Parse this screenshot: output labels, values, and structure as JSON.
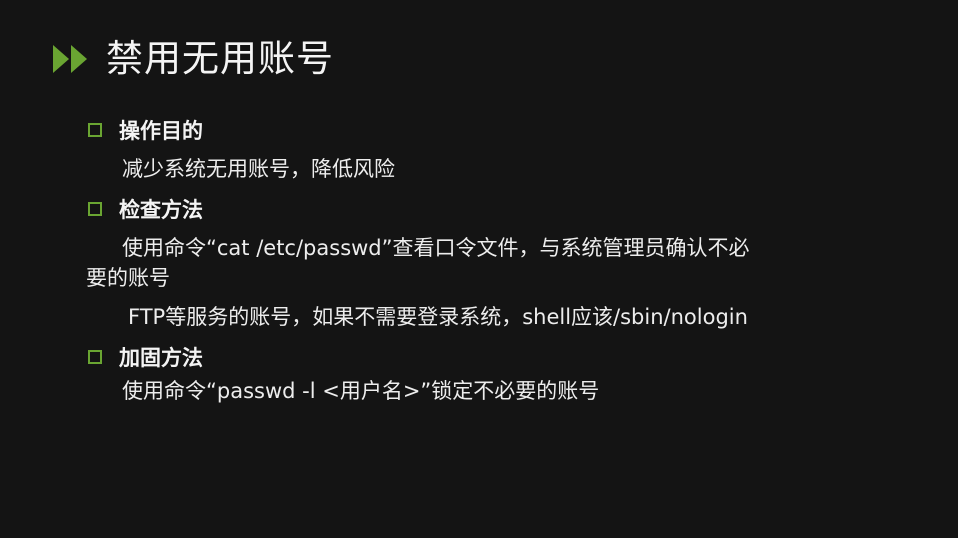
{
  "slide": {
    "title": "禁用无用账号",
    "title_icon": "double-chevron-right-icon",
    "accent_color": "#6aa532",
    "background_color": "#141414",
    "sections": [
      {
        "heading": "操作目的",
        "lines": [
          "减少系统无用账号，降低风险"
        ]
      },
      {
        "heading": "检查方法",
        "lines": [
          "使用命令“cat /etc/passwd”查看口令文件，与系统管理员确认不必",
          "要的账号",
          "FTP等服务的账号，如果不需要登录系统，shell应该/sbin/nologin"
        ]
      },
      {
        "heading": "加固方法",
        "lines": [
          "使用命令“passwd -l <用户名>”锁定不必要的账号"
        ]
      }
    ]
  }
}
